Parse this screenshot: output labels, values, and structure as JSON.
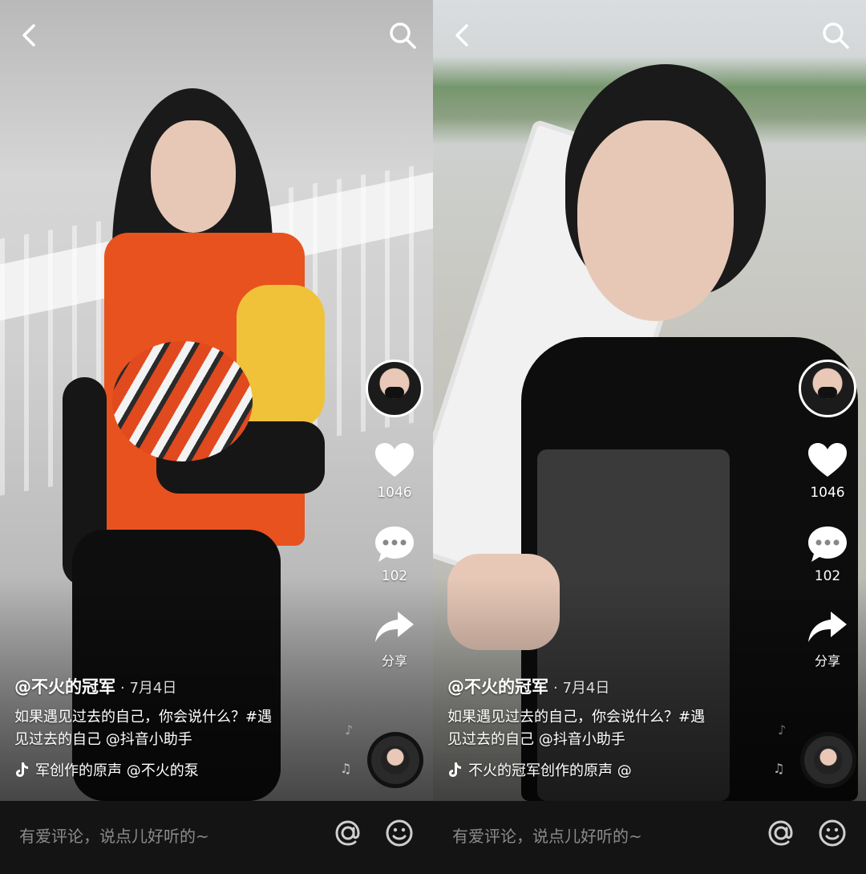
{
  "left": {
    "author": "@不火的冠军",
    "date": "· 7月4日",
    "caption_line1": "如果遇见过去的自己，你会说什么？#遇",
    "caption_line2": "见过去的自己 @抖音小助手",
    "music_text": "军创作的原声    @不火的泵",
    "likes": "1046",
    "comments": "102",
    "share_label": "分享",
    "comment_placeholder": "有爱评论，说点儿好听的~"
  },
  "right": {
    "author": "@不火的冠军",
    "date": "· 7月4日",
    "caption_line1": "如果遇见过去的自己，你会说什么？#遇",
    "caption_line2": "见过去的自己 @抖音小助手",
    "music_text": "不火的冠军创作的原声    @",
    "likes": "1046",
    "comments": "102",
    "share_label": "分享",
    "comment_placeholder": "有爱评论，说点儿好听的~"
  },
  "icons": {
    "back": "chevron-left-icon",
    "search": "search-icon",
    "like": "heart-icon",
    "comment": "comment-bubble-icon",
    "share": "share-arrow-icon",
    "at": "at-sign-icon",
    "emoji": "smiley-icon",
    "music": "tiktok-note-icon"
  },
  "colors": {
    "bar_bg": "#141414",
    "placeholder": "#8b8b8b",
    "text": "#ffffff"
  }
}
